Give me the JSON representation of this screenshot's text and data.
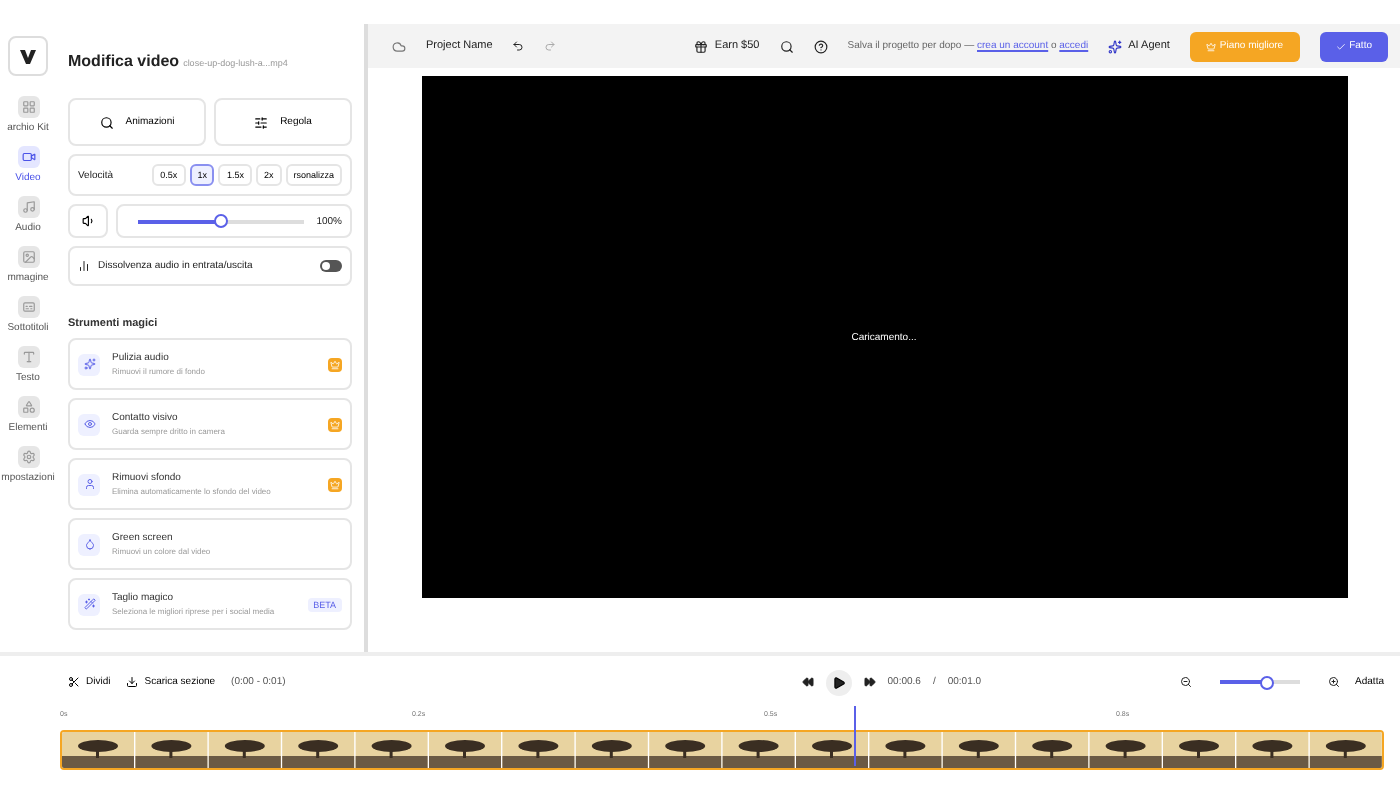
{
  "rail": {
    "items": [
      {
        "label": "archio Kit",
        "selected": false
      },
      {
        "label": "Video",
        "selected": true
      },
      {
        "label": "Audio",
        "selected": false
      },
      {
        "label": "mmagine",
        "selected": false
      },
      {
        "label": "Sottotitoli",
        "selected": false
      },
      {
        "label": "Testo",
        "selected": false
      },
      {
        "label": "Elementi",
        "selected": false
      },
      {
        "label": "mpostazioni",
        "selected": false
      }
    ]
  },
  "panel": {
    "title": "Modifica video",
    "file": "close-up-dog-lush-a...mp4",
    "actions": [
      "Animazioni",
      "Regola"
    ],
    "speed": {
      "label": "Velocità",
      "options": [
        {
          "label": "0.5x",
          "selected": false
        },
        {
          "label": "1x",
          "selected": true
        },
        {
          "label": "1.5x",
          "selected": false
        },
        {
          "label": "2x",
          "selected": false
        },
        {
          "label": "rsonalizza",
          "selected": false
        }
      ]
    },
    "volume": {
      "level": 0.5,
      "reading": "100%"
    },
    "fade": {
      "label": "Dissolvenza audio in entrata/uscita",
      "on": false
    },
    "magic_title": "Strumenti magici",
    "tools": [
      {
        "name": "Pulizia audio",
        "desc": "Rimuovi il rumore di fondo",
        "kind": "premium"
      },
      {
        "name": "Contatto visivo",
        "desc": "Guarda sempre dritto in camera",
        "kind": "premium"
      },
      {
        "name": "Rimuovi sfondo",
        "desc": "Elimina automaticamente lo sfondo del video",
        "kind": "premium"
      },
      {
        "name": "Green screen",
        "desc": "Rimuovi un colore dal video",
        "kind": "free"
      },
      {
        "name": "Taglio magico",
        "desc": "Seleziona le migliori riprese per i social media",
        "kind": "beta",
        "badge_text": "BETA"
      }
    ]
  },
  "topbar": {
    "project": "Project Name",
    "earn": "Earn $50",
    "save_text": "Salva il progetto per dopo —",
    "link1": "crea un account",
    "or": "o",
    "link2": "accedi",
    "agent": "AI Agent",
    "upgrade": "Piano migliore",
    "done": "Fatto"
  },
  "preview": {
    "status": "Caricamento..."
  },
  "timeline": {
    "split": "Dividi",
    "download": "Scarica sezione",
    "range": "(0:00 - 0:01)",
    "time": "00:00.6",
    "sep": "/",
    "total": "00:01.0",
    "zoom": {
      "level": 0.6
    },
    "fit": "Adatta",
    "ruler": [
      "0s",
      "0.2s",
      "0.5s",
      "0.8s"
    ],
    "playhead": {
      "level": 0.6
    }
  }
}
